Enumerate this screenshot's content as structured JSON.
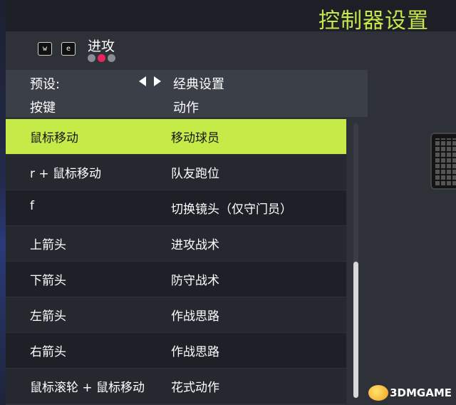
{
  "header": {
    "title": "控制器设置"
  },
  "tabs": {
    "prev_key": "w",
    "next_key": "e",
    "current": "进攻",
    "page_count": 3,
    "active_index": 1
  },
  "preset": {
    "label": "预设:",
    "value": "经典设置"
  },
  "columns": {
    "key": "按键",
    "action": "动作"
  },
  "bindings": [
    {
      "key": "鼠标移动",
      "action": "移动球员"
    },
    {
      "key": "r + 鼠标移动",
      "action": "队友跑位"
    },
    {
      "key": "f",
      "action": "切换镜头（仅守门员）"
    },
    {
      "key": "上箭头",
      "action": "进攻战术"
    },
    {
      "key": "下箭头",
      "action": "防守战术"
    },
    {
      "key": "左箭头",
      "action": "作战思路"
    },
    {
      "key": "右箭头",
      "action": "作战思路"
    },
    {
      "key": "鼠标滚轮 + 鼠标移动",
      "action": "花式动作"
    }
  ],
  "selected_index": 0,
  "watermark": "3DMGAME",
  "colors": {
    "accent": "#c6ea47",
    "active_dot": "#e8265c"
  }
}
